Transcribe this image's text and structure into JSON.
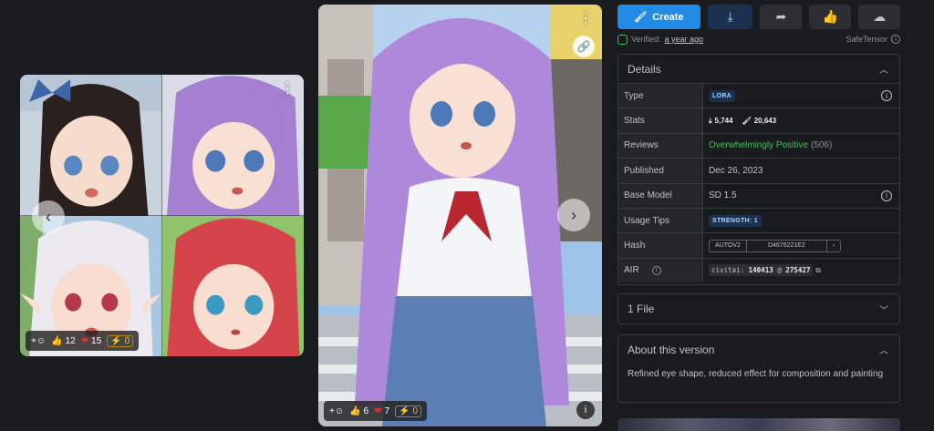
{
  "left_card": {
    "reactions": {
      "likes": "12",
      "hearts": "15",
      "buzz": "0"
    },
    "more_icon": "more-vertical-icon"
  },
  "mid_card": {
    "reactions": {
      "likes": "6",
      "hearts": "7",
      "buzz": "0"
    }
  },
  "actions": {
    "create_label": "Create"
  },
  "verified": {
    "label": "Verified:",
    "ago": "a year ago",
    "format": "SafeTensor"
  },
  "details": {
    "title": "Details",
    "rows": {
      "type": {
        "label": "Type",
        "value": "LORA"
      },
      "stats": {
        "label": "Stats",
        "downloads": "5,744",
        "generations": "20,643"
      },
      "reviews": {
        "label": "Reviews",
        "value": "Overwhelmingly Positive",
        "count": "(506)"
      },
      "published": {
        "label": "Published",
        "value": "Dec 26, 2023"
      },
      "base_model": {
        "label": "Base Model",
        "value": "SD 1.5"
      },
      "usage_tips": {
        "label": "Usage Tips",
        "value": "STRENGTH: 1"
      },
      "hash": {
        "label": "Hash",
        "type": "AUTOV2",
        "value": "D4676221E2"
      },
      "air": {
        "label": "AIR",
        "prefix": "civitai:",
        "model": "140413",
        "at": "@",
        "version": "275427"
      }
    }
  },
  "files": {
    "label": "1 File"
  },
  "about": {
    "title": "About this version",
    "text": "Refined eye shape, reduced effect for composition and painting"
  },
  "colors": {
    "accent": "#228be6",
    "positive": "#40c057",
    "background": "#1a1b1e"
  }
}
